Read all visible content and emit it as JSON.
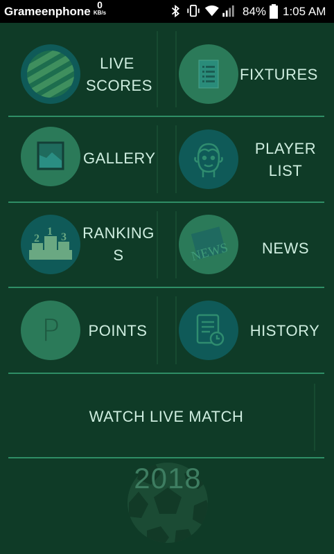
{
  "status_bar": {
    "carrier": "Grameenphone",
    "speed_value": "0",
    "speed_unit": "KB/s",
    "battery": "84%",
    "time": "1:05 AM"
  },
  "menu": {
    "live_scores_line1": "LIVE",
    "live_scores_line2": "SCORES",
    "fixtures": "FIXTURES",
    "gallery": "GALLERY",
    "player_list_line1": "PLAYER",
    "player_list_line2": "LIST",
    "rankings_line1": "RANKING",
    "rankings_line2": "S",
    "news": "NEWS",
    "points": "POINTS",
    "history": "HISTORY",
    "watch_live": "WATCH LIVE MATCH",
    "news_icon_text": "NEWS",
    "points_icon_text": "P"
  },
  "footer": {
    "year": "2018"
  },
  "colors": {
    "background": "#0f3b27",
    "divider": "#2f8e66",
    "circle_teal": "#0f5a58",
    "circle_green": "#2b7a59",
    "label": "#cfeee0"
  }
}
